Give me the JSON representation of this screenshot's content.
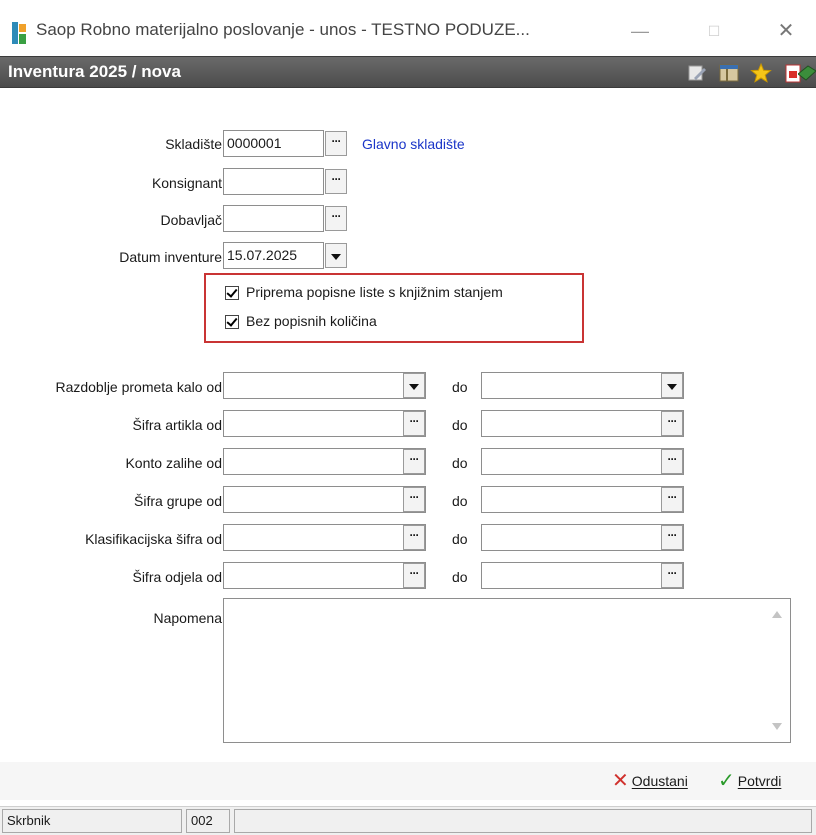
{
  "window": {
    "title": "Saop Robno materijalno poslovanje - unos - TESTNO PODUZE..."
  },
  "header": {
    "title": "Inventura 2025 / nova"
  },
  "form": {
    "skladiste": {
      "label": "Skladište",
      "value": "0000001",
      "name_link": "Glavno skladište"
    },
    "konsignant": {
      "label": "Konsignant",
      "value": ""
    },
    "dobavljac": {
      "label": "Dobavljač",
      "value": ""
    },
    "datum": {
      "label": "Datum inventure",
      "value": "15.07.2025"
    },
    "checkboxes": [
      {
        "label": "Priprema popisne liste s knjižnim stanjem",
        "checked": true
      },
      {
        "label": "Bez popisnih količina",
        "checked": true
      }
    ],
    "do_label": "do",
    "ranges": [
      {
        "label": "Razdoblje prometa kalo od",
        "from": "",
        "to": "",
        "kind": "dropdown"
      },
      {
        "label": "Šifra artikla od",
        "from": "",
        "to": "",
        "kind": "lookup"
      },
      {
        "label": "Konto zalihe od",
        "from": "",
        "to": "",
        "kind": "lookup"
      },
      {
        "label": "Šifra grupe od",
        "from": "",
        "to": "",
        "kind": "lookup"
      },
      {
        "label": "Klasifikacijska šifra od",
        "from": "",
        "to": "",
        "kind": "lookup"
      },
      {
        "label": "Šifra odjela od",
        "from": "",
        "to": "",
        "kind": "lookup"
      }
    ],
    "napomena": {
      "label": "Napomena",
      "value": ""
    }
  },
  "actions": {
    "cancel_label": "Odustani",
    "confirm_label": "Potvrdi"
  },
  "statusbar": {
    "user": "Skrbnik",
    "code": "002",
    "extra": ""
  },
  "icons": [
    "app-icon",
    "edit-icon",
    "columns-icon",
    "star-icon",
    "pdf-icon",
    "book-icon",
    "close-x-icon",
    "checkmark-icon"
  ],
  "colors": {
    "header_bg": "#555555",
    "link": "#1a35c8",
    "highlight": "#c93434"
  }
}
